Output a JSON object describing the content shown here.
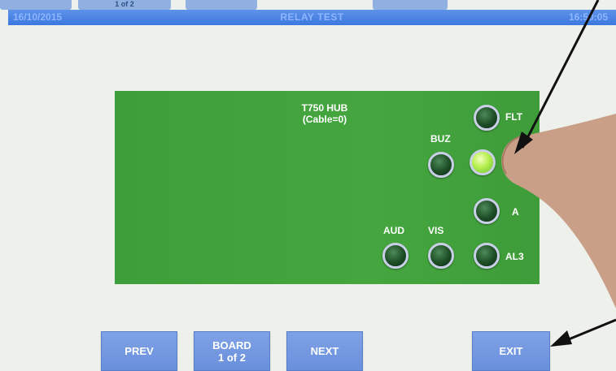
{
  "top_strip": {
    "prev_page_label": "1 of 2"
  },
  "title_bar": {
    "date": "16/10/2015",
    "title": "RELAY TEST",
    "time": "16:50:05"
  },
  "panel": {
    "hub_line1": "T750 HUB",
    "hub_line2": "(Cable=0)",
    "relays": [
      {
        "label": "FLT",
        "state": "off"
      },
      {
        "label": "BUZ",
        "state": "off"
      },
      {
        "label": "",
        "state": "off"
      },
      {
        "label": "",
        "state": "on"
      },
      {
        "label": "A",
        "state": "off"
      },
      {
        "label": "AUD",
        "state": "off"
      },
      {
        "label": "VIS",
        "state": "off"
      },
      {
        "label": "AL3",
        "state": "off"
      }
    ]
  },
  "buttons": {
    "prev": "PREV",
    "board_line1": "BOARD",
    "board_line2": "1 of 2",
    "next": "NEXT",
    "exit": "EXIT"
  },
  "colors": {
    "panel_green": "#45a63f",
    "title_bar_blue": "#4a82e3",
    "button_blue": "#7596e0",
    "led_off": "#1d4d27",
    "led_on": "#b6ef4e"
  }
}
